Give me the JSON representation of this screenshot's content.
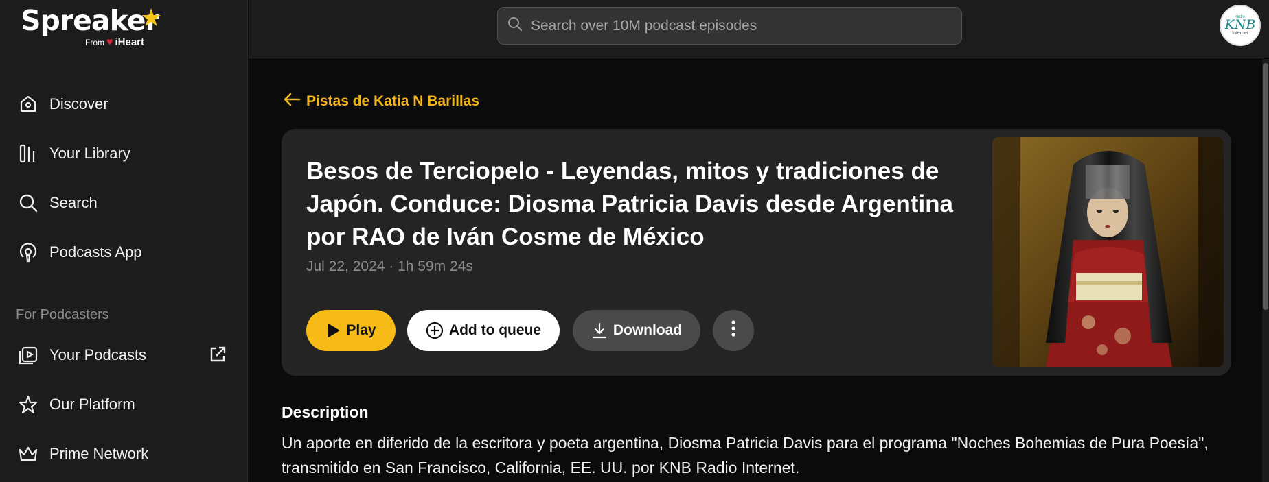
{
  "brand": {
    "name": "Spreaker",
    "from": "From",
    "partner": "iHeart"
  },
  "search": {
    "placeholder": "Search over 10M podcast episodes"
  },
  "user": {
    "avatar_text": "KNB",
    "avatar_top": "radio",
    "avatar_bottom": "Internet"
  },
  "sidebar": {
    "items": [
      {
        "label": "Discover",
        "icon": "discover-icon"
      },
      {
        "label": "Your Library",
        "icon": "library-icon"
      },
      {
        "label": "Search",
        "icon": "search-icon"
      },
      {
        "label": "Podcasts App",
        "icon": "podcast-icon"
      }
    ],
    "section_label": "For Podcasters",
    "podcaster_items": [
      {
        "label": "Your Podcasts",
        "icon": "your-podcasts-icon"
      },
      {
        "label": "Our Platform",
        "icon": "star-icon"
      },
      {
        "label": "Prime Network",
        "icon": "crown-icon"
      }
    ]
  },
  "back_link": "Pistas de Katia N Barillas",
  "episode": {
    "title": "Besos de Terciopelo - Leyendas, mitos y tradiciones de Japón. Conduce: Diosma Patricia Davis desde Argentina por RAO de Iván Cosme de México",
    "meta": "Jul 22, 2024 · 1h 59m 24s",
    "buttons": {
      "play": "Play",
      "queue": "Add to queue",
      "download": "Download"
    }
  },
  "description": {
    "heading": "Description",
    "text": "Un aporte en diferido de la escritora y poeta argentina, Diosma Patricia Davis para el programa \"Noches Bohemias de Pura Poesía\", transmitido en San Francisco, California, EE. UU. por KNB Radio Internet."
  },
  "colors": {
    "accent": "#f7bb17",
    "background": "#0b0b0b",
    "sidebar": "#1c1c1c",
    "card": "#242424"
  }
}
